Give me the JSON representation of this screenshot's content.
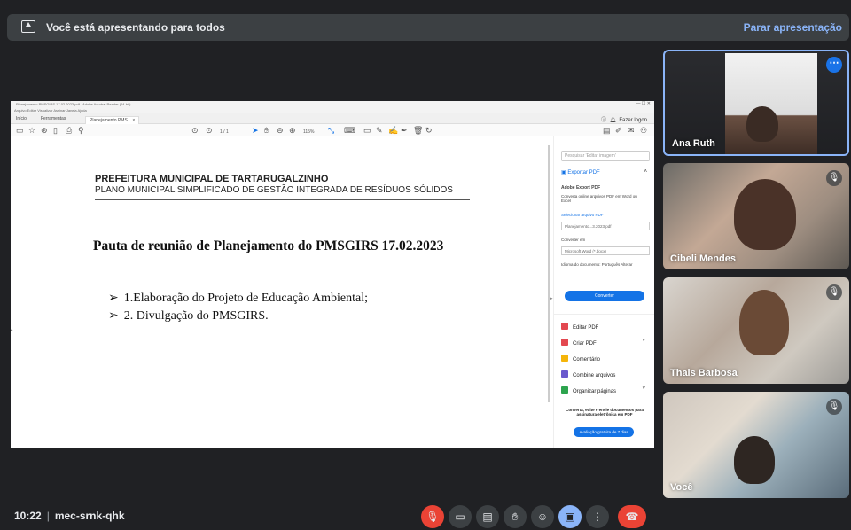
{
  "presentation_bar": {
    "message": "Você está apresentando para todos",
    "stop_label": "Parar apresentação"
  },
  "shared_window": {
    "title": "Planejamento PMSGIRS 17.02.2023.pdf - Adobe Acrobat Reader (64-bit)",
    "menu": "Arquivo  Editar  Visualizar  Assinar  Janela  Ajuda",
    "tabs": [
      "Início",
      "Ferramentas",
      "Planejamento PMS... ×"
    ],
    "signin": "Fazer logon",
    "zoom": "115%",
    "page": "1 / 1",
    "pdf": {
      "header1": "PREFEITURA MUNICIPAL DE TARTARUGALZINHO",
      "header2": "PLANO MUNICIPAL SIMPLIFICADO DE GESTÃO INTEGRADA DE RESÍDUOS SÓLIDOS",
      "title": "Pauta de reunião de Planejamento do PMSGIRS 17.02.2023",
      "items": [
        "1.Elaboração do Projeto de Educação Ambiental;",
        "2. Divulgação do PMSGIRS."
      ]
    },
    "pane": {
      "search_placeholder": "Pesquisar 'Editar imagem'",
      "export_pdf": "Exportar PDF",
      "adobe_export": "Adobe Export PDF",
      "desc": "Converta online arquivos PDF em Word ou Excel",
      "select_file": "Selecionar arquivo PDF",
      "file": "Planejamento...3.2023.pdf",
      "convert_to": "Converter em",
      "format": "Microsoft Word (*.docx)",
      "language": "Idioma do documento: Português  Alterar",
      "convert_btn": "Converter",
      "tools": [
        {
          "label": "Editar PDF",
          "color": "#e34850"
        },
        {
          "label": "Criar PDF",
          "color": "#e34850"
        },
        {
          "label": "Comentário",
          "color": "#f5b50a"
        },
        {
          "label": "Combine arquivos",
          "color": "#6a5acd"
        },
        {
          "label": "Organizar páginas",
          "color": "#2da44e"
        }
      ],
      "promo": "Converta, edite e envie documentos para assinatura eletrônica em PDF",
      "trial_btn": "Avaliação gratuita de 7 dias"
    }
  },
  "participants": [
    {
      "name": "Ana Ruth"
    },
    {
      "name": "Cibeli Mendes"
    },
    {
      "name": "Thais Barbosa"
    },
    {
      "name": "Você"
    }
  ],
  "bottom": {
    "time": "10:22",
    "meeting_code": "mec-srnk-qhk"
  }
}
